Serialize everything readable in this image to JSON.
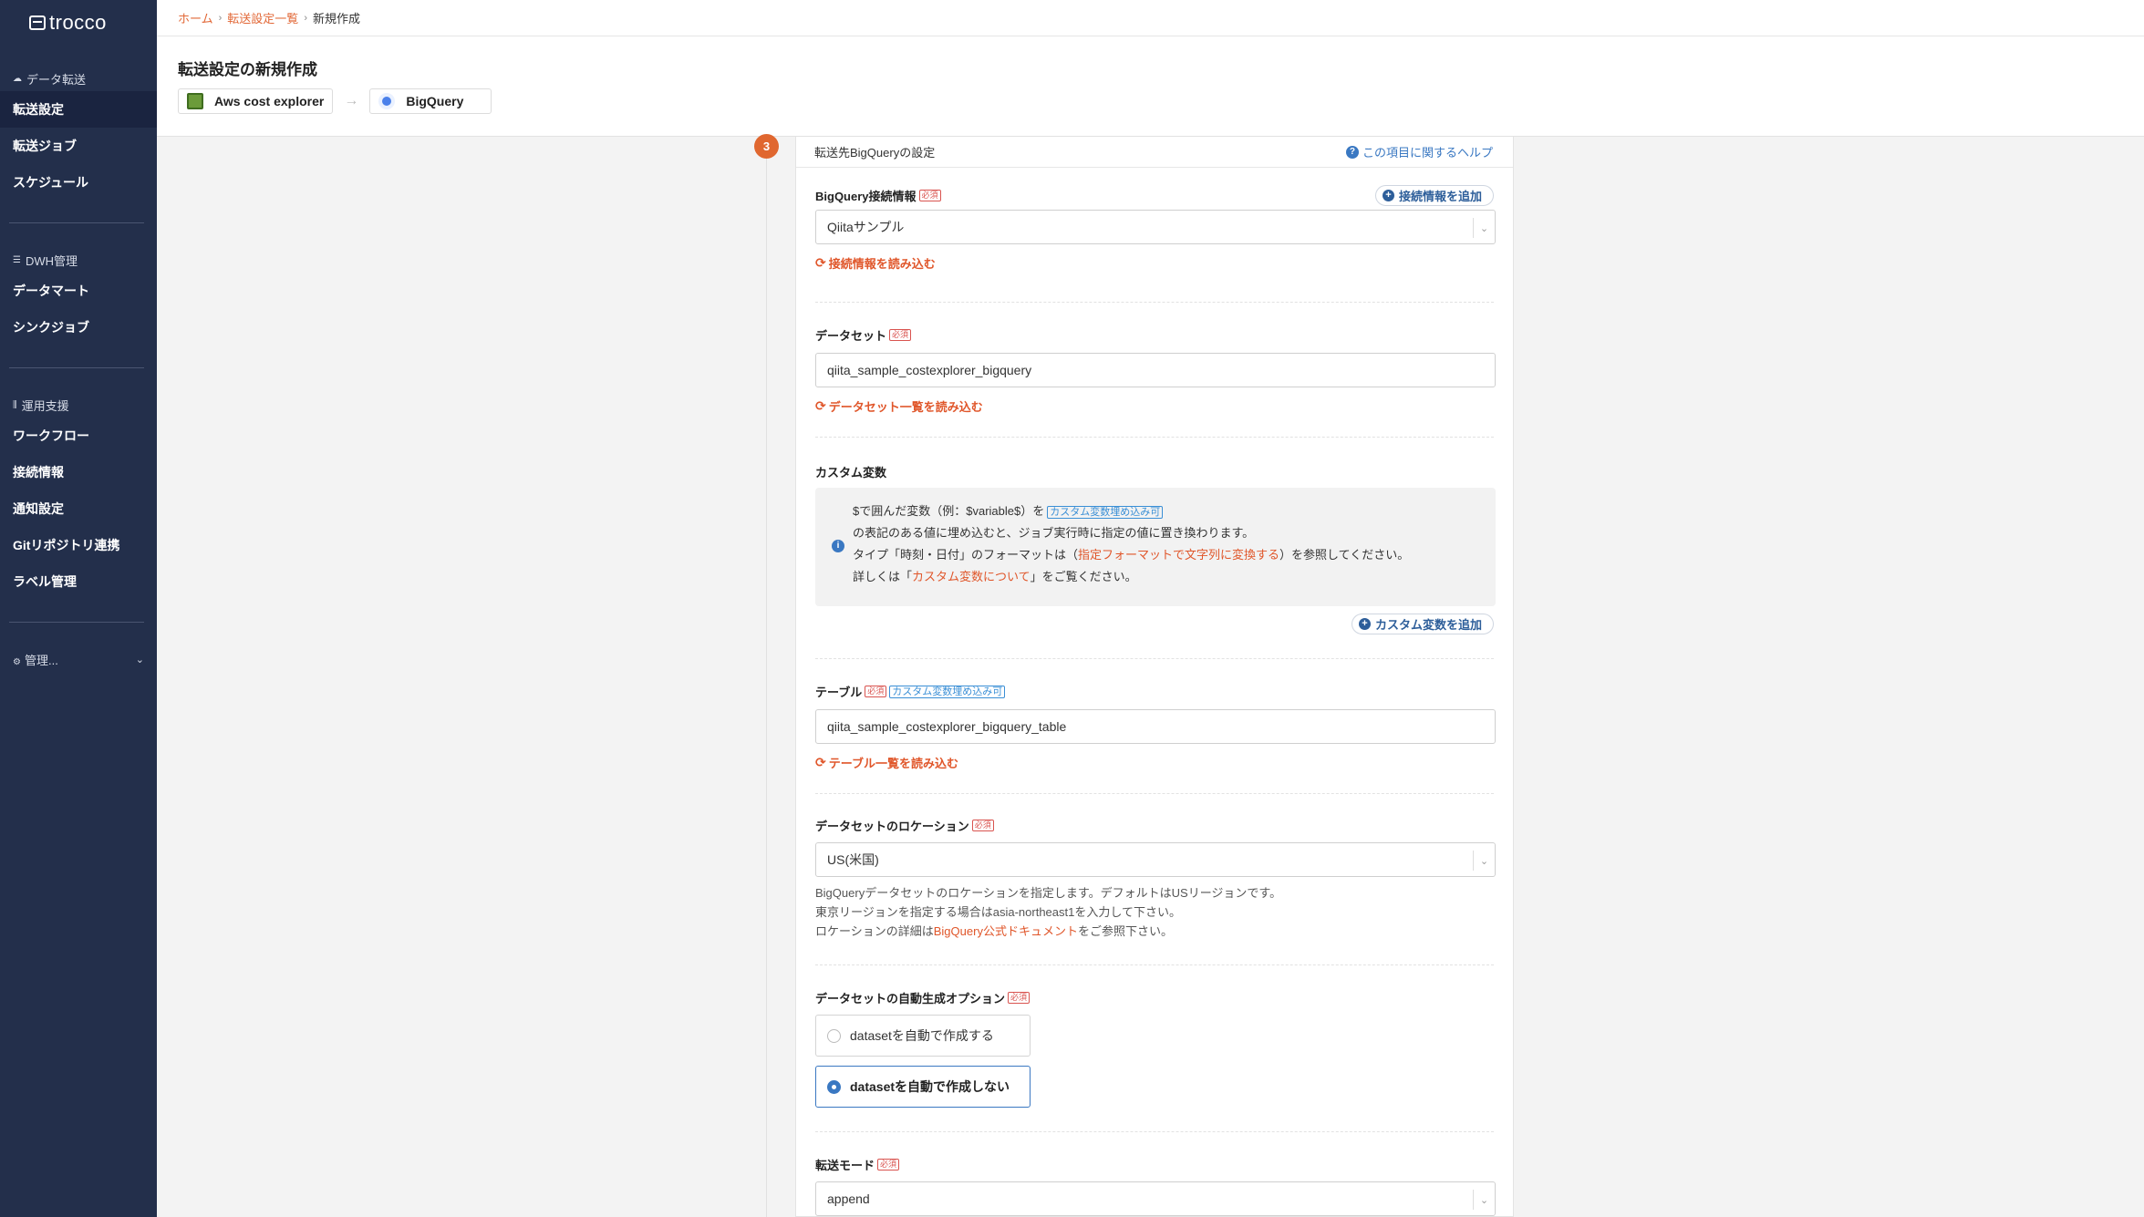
{
  "app": {
    "logo_text": "trocco"
  },
  "sidebar": {
    "sections": [
      {
        "header": "データ転送",
        "items": [
          "転送設定",
          "転送ジョブ",
          "スケジュール"
        ]
      },
      {
        "header": "DWH管理",
        "items": [
          "データマート",
          "シンクジョブ"
        ]
      },
      {
        "header": "運用支援",
        "items": [
          "ワークフロー",
          "接続情報",
          "通知設定",
          "Gitリポジトリ連携",
          "ラベル管理"
        ]
      }
    ],
    "collapse_label": "管理...",
    "active_item": "転送設定"
  },
  "breadcrumb": {
    "home": "ホーム",
    "list": "転送設定一覧",
    "current": "新規作成"
  },
  "page": {
    "title": "転送設定の新規作成",
    "source": "Aws cost explorer",
    "destination": "BigQuery"
  },
  "panel": {
    "step_number": "3",
    "title": "転送先BigQueryの設定",
    "help_link": "この項目に関するヘルプ"
  },
  "form": {
    "required_badge": "必須",
    "var_badge": "カスタム変数埋め込み可",
    "connection": {
      "label": "BigQuery接続情報",
      "add_button": "接続情報を追加",
      "value": "Qiitaサンプル",
      "reload": "接続情報を読み込む"
    },
    "dataset": {
      "label": "データセット",
      "value": "qiita_sample_costexplorer_bigquery",
      "reload": "データセット一覧を読み込む"
    },
    "custom_vars": {
      "label": "カスタム変数",
      "line1_a": "$で囲んだ変数（例：$variable$）を",
      "line1_badge": "カスタム変数埋め込み可",
      "line2": "の表記のある値に埋め込むと、ジョブ実行時に指定の値に置き換わります。",
      "line3_a": "タイプ「時刻・日付」のフォーマットは（",
      "line3_link": "指定フォーマットで文字列に変換する",
      "line3_b": "）を参照してください。",
      "line4_a": "詳しくは「",
      "line4_link": "カスタム変数について",
      "line4_b": "」をご覧ください。",
      "add_button": "カスタム変数を追加"
    },
    "table": {
      "label": "テーブル",
      "var_badge": "カスタム変数埋め込み可",
      "value": "qiita_sample_costexplorer_bigquery_table",
      "reload": "テーブル一覧を読み込む"
    },
    "location": {
      "label": "データセットのロケーション",
      "value": "US(米国)",
      "hint1": "BigQueryデータセットのロケーションを指定します。デフォルトはUSリージョンです。",
      "hint2": "東京リージョンを指定する場合はasia-northeast1を入力して下さい。",
      "hint3_a": "ロケーションの詳細は",
      "hint3_link": "BigQuery公式ドキュメント",
      "hint3_b": "をご参照下さい。"
    },
    "auto_create": {
      "label": "データセットの自動生成オプション",
      "options": [
        "datasetを自動で作成する",
        "datasetを自動で作成しない"
      ],
      "selected_index": 1
    },
    "mode": {
      "label": "転送モード",
      "value": "append"
    }
  },
  "colors": {
    "sidebar_bg": "#232f4b",
    "accent_orange": "#e0562a",
    "link_blue": "#3a78c2"
  }
}
